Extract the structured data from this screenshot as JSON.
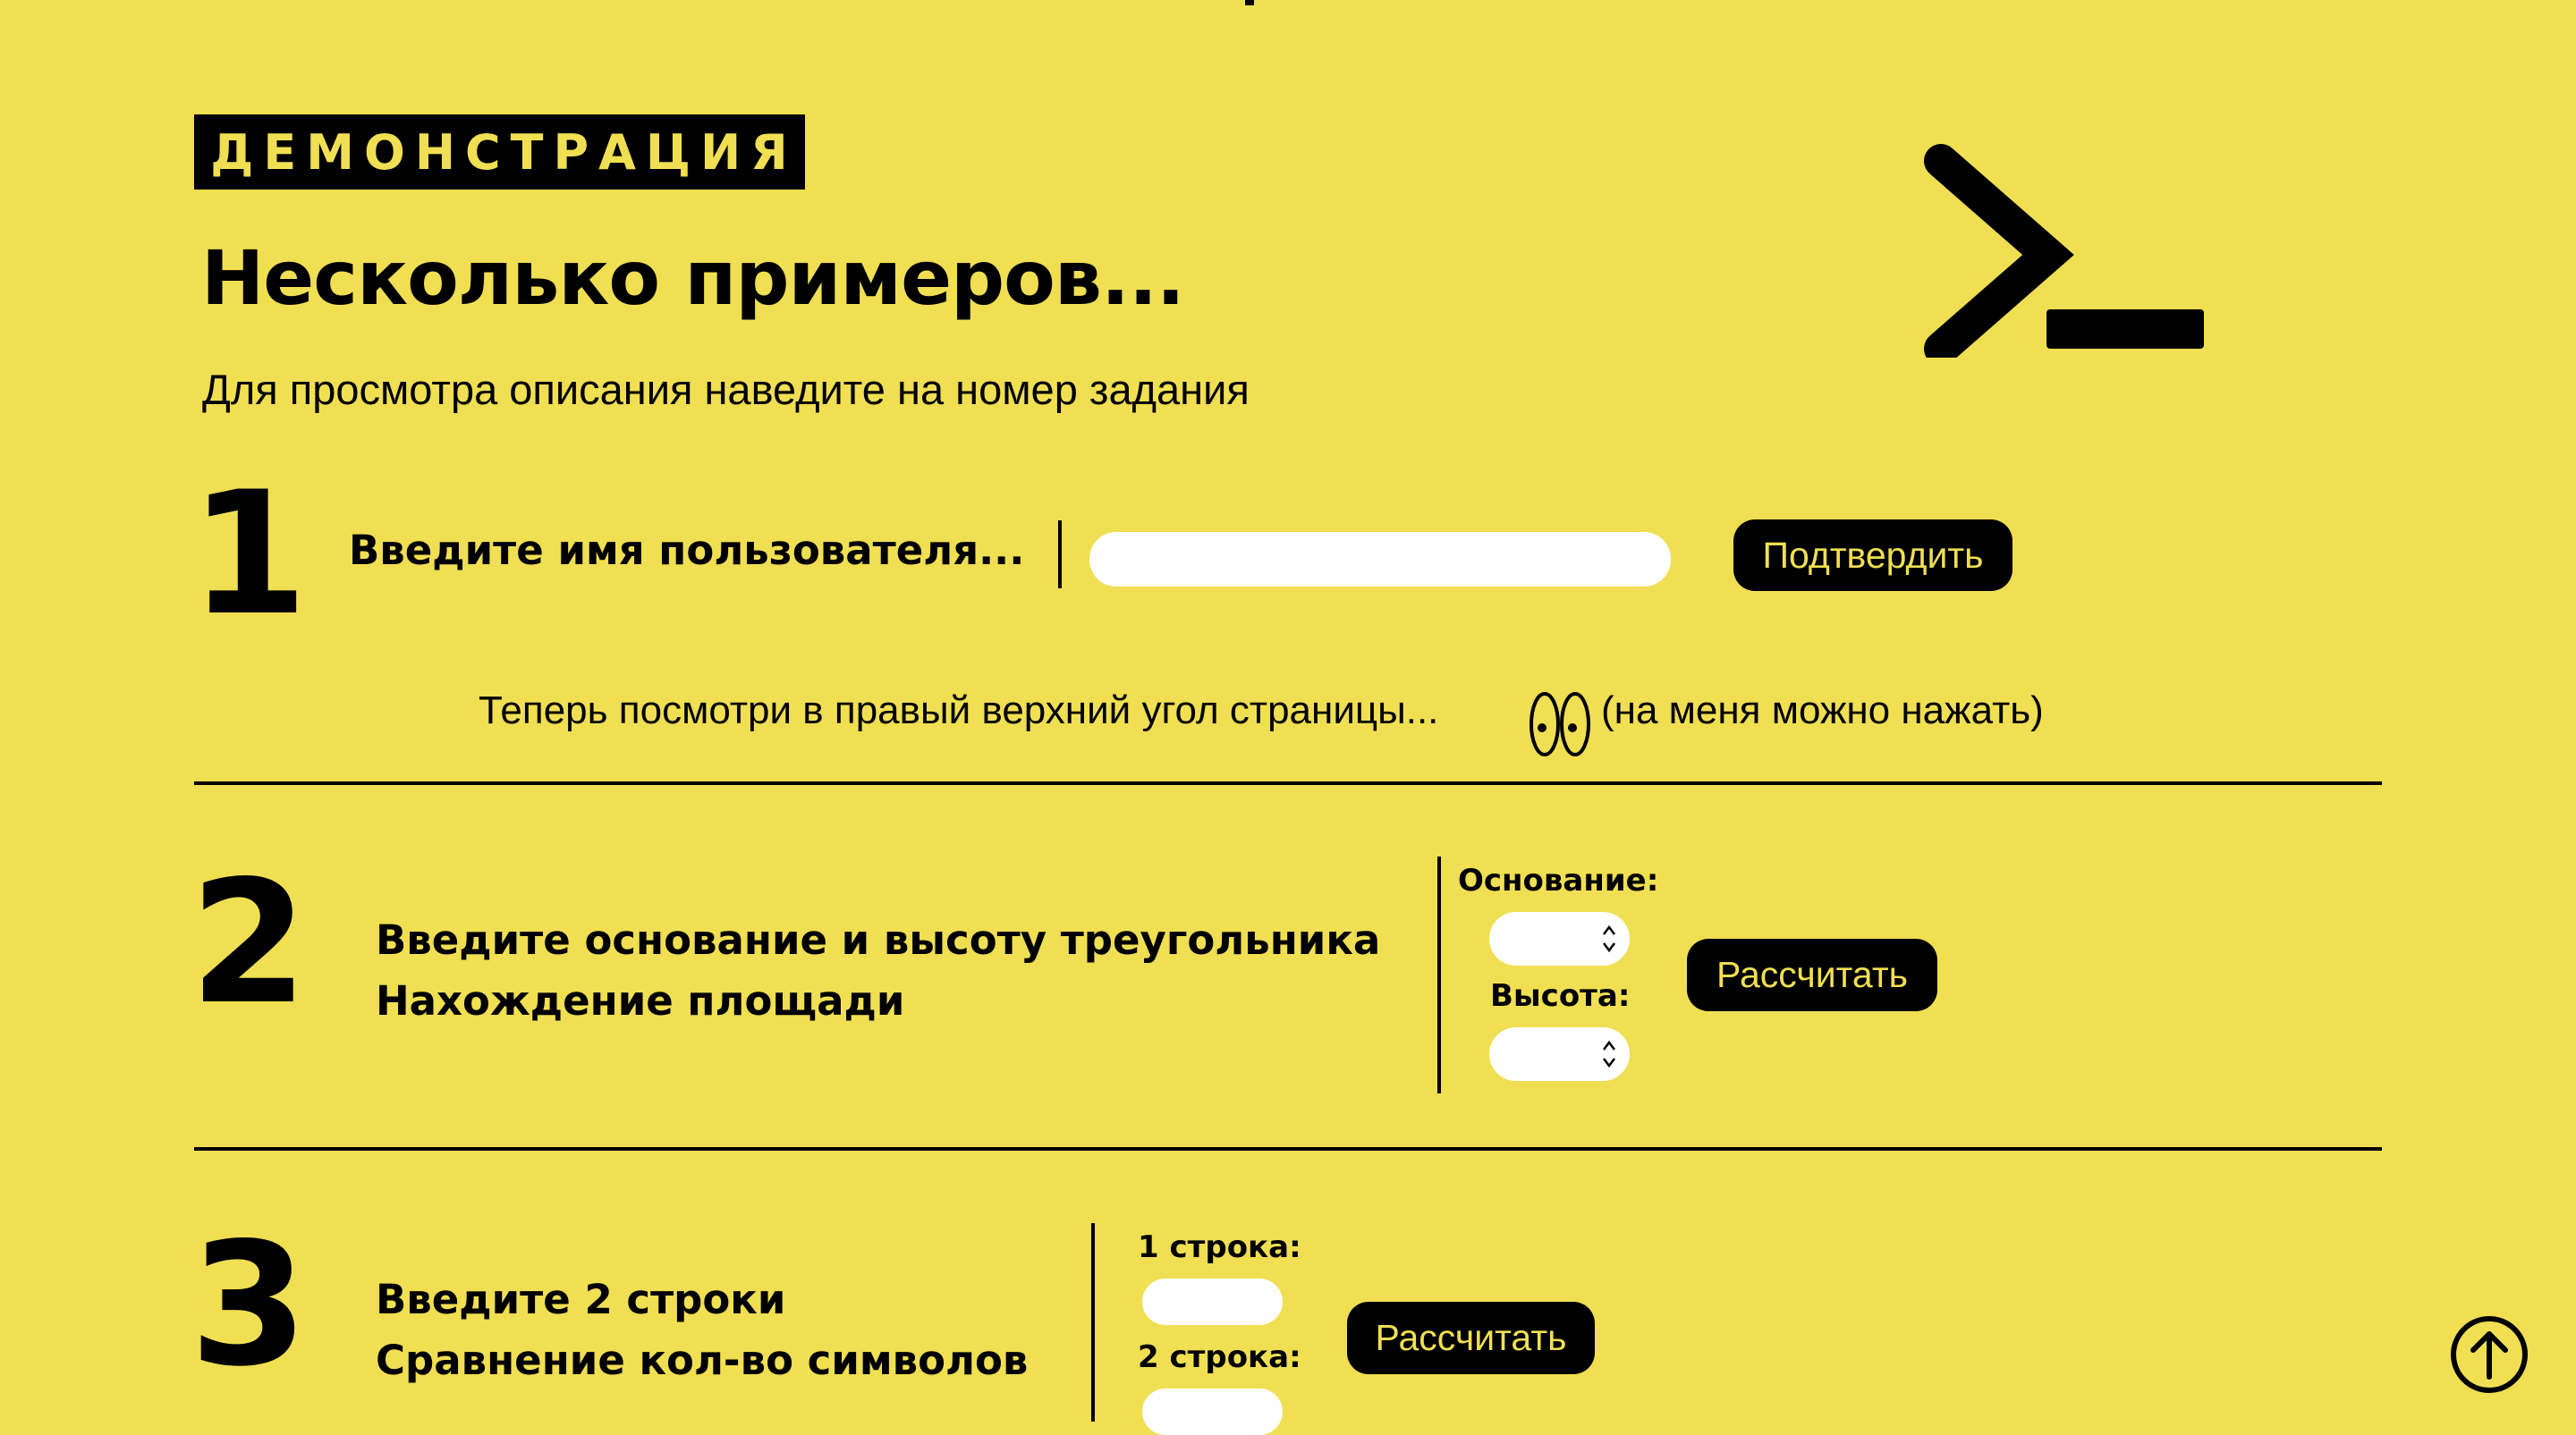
{
  "header": {
    "badge": "ДЕМОНСТРАЦИЯ",
    "title": "Несколько примеров...",
    "subtitle": "Для просмотра описания наведите на номер задания",
    "terminal_icon": "terminal-prompt-icon"
  },
  "task1": {
    "number": "1",
    "label": "Введите имя пользователя...",
    "input_value": "",
    "button": "Подтвердить",
    "hint": "Теперь посмотри в правый верхний угол страницы...",
    "hint_icon": "eyes-icon",
    "hint_note": "(на меня можно нажать)"
  },
  "task2": {
    "number": "2",
    "line1": "Введите основание и высоту треугольника",
    "line2": "Нахождение площади",
    "base_label": "Основание:",
    "base_value": "",
    "height_label": "Высота:",
    "height_value": "",
    "button": "Рассчитать"
  },
  "task3": {
    "number": "3",
    "line1": "Введите 2 строки",
    "line2": "Сравнение кол-во символов",
    "str1_label": "1 строка:",
    "str1_value": "",
    "str2_label": "2 строка:",
    "str2_value": "",
    "button": "Рассчитать"
  },
  "scroll_top_icon": "arrow-up-circle-icon",
  "colors": {
    "background": "#f0df52",
    "foreground": "#000000",
    "input": "#ffffff"
  }
}
